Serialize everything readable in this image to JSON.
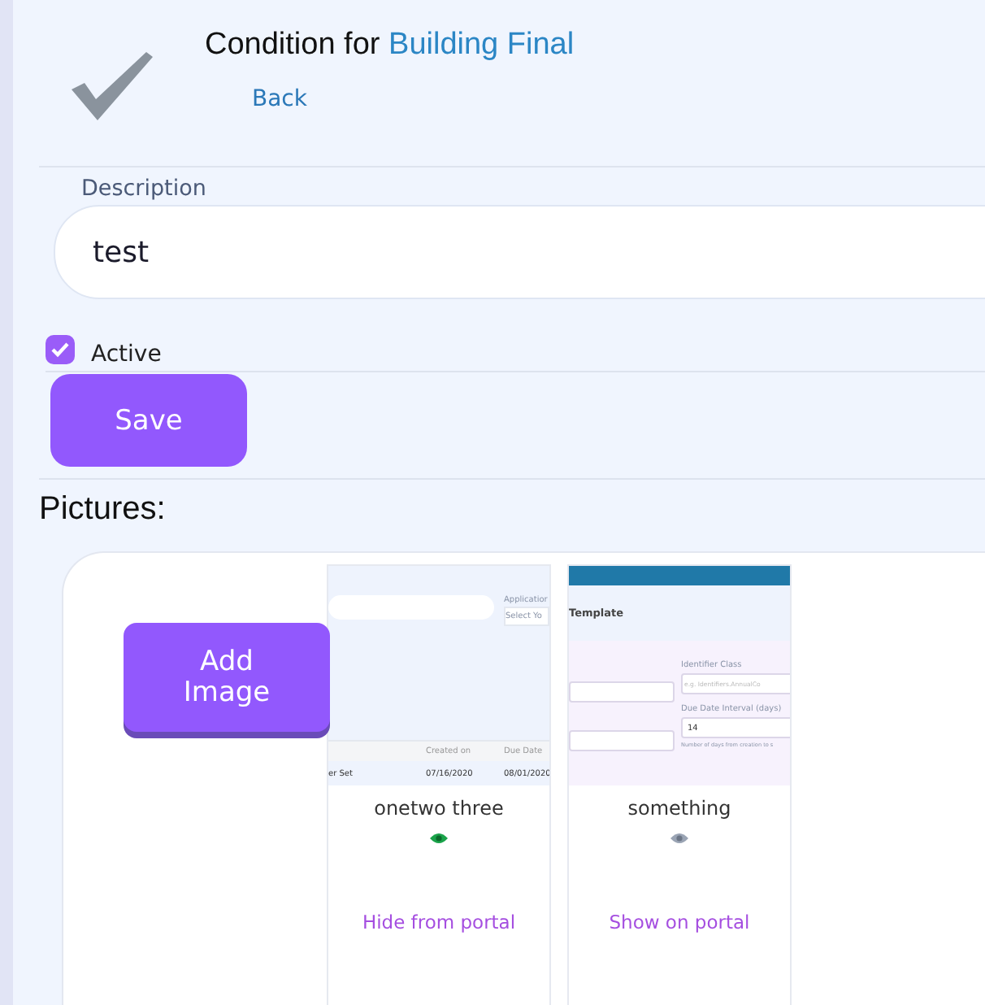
{
  "header": {
    "title": "Condition for",
    "title_link": "Building Final",
    "back": "Back"
  },
  "description": {
    "label": "Description",
    "value": "test"
  },
  "active": {
    "label": "Active",
    "checked": true
  },
  "save": "Save",
  "pictures_heading": "Pictures:",
  "add_image": "Add Image",
  "pictures": [
    {
      "kind": "table-screen",
      "caption": "onetwo three",
      "on_portal": true,
      "action": "Hide from portal",
      "screen": {
        "field_label": "Applicatior",
        "select": "Select Yo",
        "columns": [
          "Created on",
          "Due Date"
        ],
        "row": [
          "er Set",
          "07/16/2020",
          "08/01/2020"
        ]
      }
    },
    {
      "kind": "form-screen",
      "caption": "something",
      "on_portal": false,
      "action": "Show on portal",
      "screen": {
        "title": "Template",
        "labels": [
          "Identifier Class",
          "Due Date Interval (days)"
        ],
        "placeholder": "e.g. Identifiers.AnnualCo",
        "value": "14",
        "hint": "Number of days from creation to s"
      }
    }
  ]
}
